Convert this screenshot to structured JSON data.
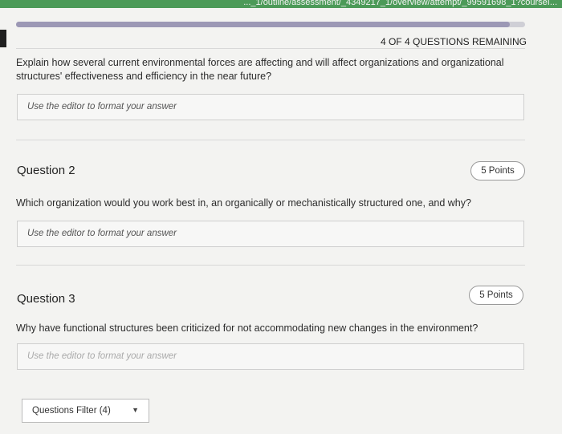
{
  "browser": {
    "url_fragment": "..._1/outline/assessment/_4349217_1/overview/attempt/_99591698_1?courseI..."
  },
  "quiz": {
    "remaining": "4 OF 4 QUESTIONS REMAINING",
    "progress_fraction": 0.97
  },
  "questions": [
    {
      "title": "",
      "points": "",
      "text": "Explain how several current environmental forces are affecting and will affect organizations and organizational structures' effectiveness and efficiency in the near future?",
      "answer_placeholder": "Use the editor to format your answer"
    },
    {
      "title": "Question 2",
      "points": "5 Points",
      "text": "Which organization would you work best in, an organically or mechanistically structured one, and why?",
      "answer_placeholder": "Use the editor to format your answer"
    },
    {
      "title": "Question 3",
      "points": "5 Points",
      "text": "Why have functional structures been criticized for not accommodating new changes in the environment?",
      "answer_placeholder": "Use the editor to format your answer"
    }
  ],
  "filter": {
    "label": "Questions Filter (4)",
    "icon": "caret-down-icon"
  },
  "colors": {
    "url_bar": "#4c9a58",
    "progress": "#9c98b5"
  }
}
